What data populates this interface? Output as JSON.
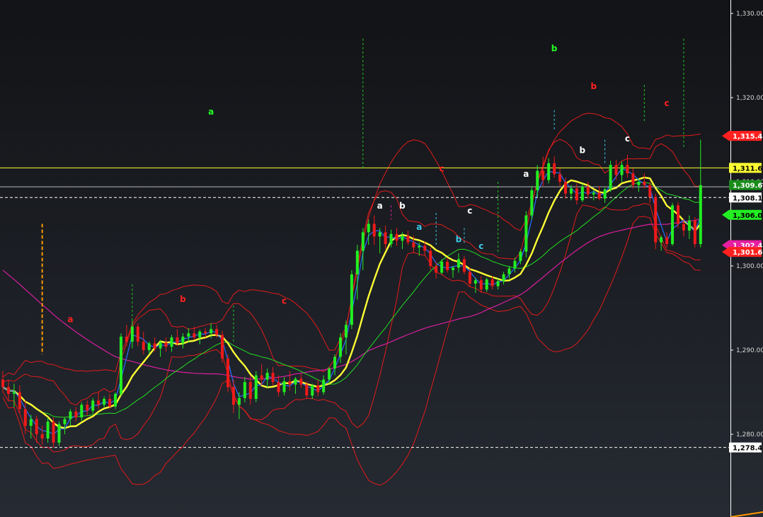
{
  "chart_data": {
    "type": "candlestick",
    "y_axis": {
      "min": 1275,
      "max": 1332,
      "ticks": [
        "1,330.00",
        "1,320.00",
        "1,310.00",
        "1,300.00",
        "1,290.00",
        "1,280.00"
      ],
      "tick_values": [
        1330,
        1320,
        1310,
        1300,
        1290,
        1280
      ],
      "position": "right"
    },
    "grid": false,
    "price_labels": [
      {
        "text": "1,315.45",
        "value": 1315.45,
        "bg": "#ff2020",
        "fg": "#ffffff",
        "shape": "arrow"
      },
      {
        "text": "1,311.65",
        "value": 1311.65,
        "bg": "#ffff33",
        "fg": "#000000",
        "shape": "box"
      },
      {
        "text": "1,309.61",
        "value": 1309.61,
        "bg": "#1a8c1a",
        "fg": "#ffffff",
        "shape": "box"
      },
      {
        "text": "1,308.13",
        "value": 1308.13,
        "bg": "#ffffff",
        "fg": "#000000",
        "shape": "box"
      },
      {
        "text": "1,306.07",
        "value": 1306.07,
        "bg": "#22ee22",
        "fg": "#000000",
        "shape": "arrow"
      },
      {
        "text": "1,302.47",
        "value": 1302.47,
        "bg": "#e61ea0",
        "fg": "#ffffff",
        "shape": "arrow"
      },
      {
        "text": "1,301.67",
        "value": 1301.67,
        "bg": "#ff2020",
        "fg": "#ffffff",
        "shape": "arrow"
      },
      {
        "text": "1,278.43",
        "value": 1278.43,
        "bg": "#ffffff",
        "fg": "#000000",
        "shape": "box"
      }
    ],
    "horizontal_lines": [
      {
        "value": 1311.65,
        "color": "#ffff33",
        "style": "solid"
      },
      {
        "value": 1309.4,
        "color": "#bbbbbb",
        "style": "solid"
      },
      {
        "value": 1308.13,
        "color": "#ffffff",
        "style": "dashed"
      },
      {
        "value": 1278.43,
        "color": "#ffffff",
        "style": "dashed"
      }
    ],
    "wave_labels": [
      {
        "text": "a",
        "bar": 37,
        "value": 1318.0,
        "color": "#22ff22"
      },
      {
        "text": "b",
        "bar": 98,
        "value": 1325.5,
        "color": "#22ff22"
      },
      {
        "text": "a",
        "bar": 12,
        "value": 1293.3,
        "color": "#ff2020"
      },
      {
        "text": "b",
        "bar": 32,
        "value": 1295.7,
        "color": "#ff2020"
      },
      {
        "text": "c",
        "bar": 50,
        "value": 1295.5,
        "color": "#ff2020"
      },
      {
        "text": "c",
        "bar": 78,
        "value": 1311.2,
        "color": "#ff2020"
      },
      {
        "text": "b",
        "bar": 105,
        "value": 1321.0,
        "color": "#ff2020"
      },
      {
        "text": "c",
        "bar": 118,
        "value": 1319.0,
        "color": "#ff2020"
      },
      {
        "text": "a",
        "bar": 67,
        "value": 1306.8,
        "color": "#ffffff"
      },
      {
        "text": "b",
        "bar": 71,
        "value": 1306.8,
        "color": "#ffffff"
      },
      {
        "text": "c",
        "bar": 83,
        "value": 1306.2,
        "color": "#ffffff"
      },
      {
        "text": "a",
        "bar": 93,
        "value": 1310.6,
        "color": "#ffffff"
      },
      {
        "text": "b",
        "bar": 103,
        "value": 1313.4,
        "color": "#ffffff"
      },
      {
        "text": "c",
        "bar": 111,
        "value": 1314.8,
        "color": "#ffffff"
      },
      {
        "text": "a",
        "bar": 74,
        "value": 1304.3,
        "color": "#3fc8e6"
      },
      {
        "text": "b",
        "bar": 81,
        "value": 1302.8,
        "color": "#3fc8e6"
      },
      {
        "text": "c",
        "bar": 85,
        "value": 1302.0,
        "color": "#3fc8e6"
      }
    ],
    "vertical_markers": [
      {
        "bar": 7,
        "top": 1305.0,
        "bottom": 1289.5,
        "color": "#ff9900"
      },
      {
        "bar": 64,
        "top": 1327.0,
        "bottom": 1311.5,
        "color": "#22cc22"
      },
      {
        "bar": 98,
        "top": 1318.5,
        "bottom": 1316.2,
        "color": "#3fc8e6"
      },
      {
        "bar": 114,
        "top": 1321.5,
        "bottom": 1317.2,
        "color": "#22cc22"
      },
      {
        "bar": 121,
        "top": 1327.0,
        "bottom": 1314.0,
        "color": "#22cc22"
      },
      {
        "bar": 23,
        "top": 1297.8,
        "bottom": 1293.5,
        "color": "#22cc22"
      },
      {
        "bar": 41,
        "top": 1295.3,
        "bottom": 1290.8,
        "color": "#22cc22"
      },
      {
        "bar": 88,
        "top": 1310.0,
        "bottom": 1301.5,
        "color": "#22cc22"
      },
      {
        "bar": 77,
        "top": 1306.3,
        "bottom": 1302.5,
        "color": "#3fc8e6"
      },
      {
        "bar": 82,
        "top": 1304.5,
        "bottom": 1302.5,
        "color": "#3fc8e6"
      },
      {
        "bar": 107,
        "top": 1315.0,
        "bottom": 1312.0,
        "color": "#3fc8e6"
      },
      {
        "bar": 69,
        "top": 1307.2,
        "bottom": 1305.5,
        "color": "#e61ea0"
      }
    ],
    "candles": [
      [
        1286.5,
        1287.5,
        1285.0,
        1285.6
      ],
      [
        1285.6,
        1286.4,
        1284.0,
        1284.8
      ],
      [
        1284.8,
        1286.0,
        1283.2,
        1285.0
      ],
      [
        1285.0,
        1285.8,
        1282.5,
        1283.0
      ],
      [
        1283.0,
        1284.0,
        1280.0,
        1281.0
      ],
      [
        1281.0,
        1282.3,
        1279.5,
        1281.8
      ],
      [
        1281.8,
        1282.2,
        1279.0,
        1280.0
      ],
      [
        1280.0,
        1281.0,
        1278.8,
        1279.5
      ],
      [
        1279.5,
        1282.0,
        1279.0,
        1281.5
      ],
      [
        1281.5,
        1282.0,
        1278.4,
        1279.0
      ],
      [
        1279.0,
        1281.5,
        1278.6,
        1281.2
      ],
      [
        1281.2,
        1282.0,
        1280.0,
        1281.8
      ],
      [
        1281.8,
        1283.0,
        1281.0,
        1282.7
      ],
      [
        1282.7,
        1283.2,
        1281.5,
        1282.0
      ],
      [
        1282.0,
        1283.8,
        1281.6,
        1283.5
      ],
      [
        1283.5,
        1284.0,
        1282.2,
        1282.8
      ],
      [
        1282.8,
        1284.3,
        1282.4,
        1284.0
      ],
      [
        1284.0,
        1285.0,
        1283.0,
        1283.5
      ],
      [
        1283.5,
        1284.5,
        1283.2,
        1284.2
      ],
      [
        1284.2,
        1284.8,
        1283.0,
        1283.3
      ],
      [
        1283.3,
        1285.0,
        1283.0,
        1284.8
      ],
      [
        1284.8,
        1292.0,
        1284.5,
        1291.6
      ],
      [
        1291.6,
        1293.0,
        1290.5,
        1291.0
      ],
      [
        1291.0,
        1293.5,
        1290.2,
        1292.8
      ],
      [
        1292.8,
        1293.2,
        1290.5,
        1291.0
      ],
      [
        1291.0,
        1292.2,
        1289.5,
        1290.0
      ],
      [
        1290.0,
        1291.0,
        1289.5,
        1290.8
      ],
      [
        1290.8,
        1291.5,
        1289.8,
        1290.2
      ],
      [
        1290.2,
        1291.2,
        1289.2,
        1290.9
      ],
      [
        1290.9,
        1291.5,
        1289.8,
        1290.4
      ],
      [
        1290.4,
        1291.8,
        1289.8,
        1291.5
      ],
      [
        1291.5,
        1292.5,
        1290.5,
        1290.8
      ],
      [
        1290.8,
        1292.0,
        1290.2,
        1291.6
      ],
      [
        1291.6,
        1292.6,
        1290.9,
        1292.0
      ],
      [
        1292.0,
        1292.8,
        1291.2,
        1291.5
      ],
      [
        1291.5,
        1292.4,
        1290.7,
        1292.2
      ],
      [
        1292.2,
        1292.6,
        1291.5,
        1292.0
      ],
      [
        1292.0,
        1293.2,
        1291.4,
        1292.5
      ],
      [
        1292.5,
        1293.0,
        1291.5,
        1291.8
      ],
      [
        1291.8,
        1292.3,
        1288.5,
        1289.0
      ],
      [
        1289.0,
        1289.5,
        1285.0,
        1285.6
      ],
      [
        1285.6,
        1286.5,
        1282.5,
        1283.5
      ],
      [
        1283.5,
        1285.0,
        1281.8,
        1284.3
      ],
      [
        1284.3,
        1286.8,
        1283.8,
        1286.2
      ],
      [
        1286.2,
        1287.0,
        1283.5,
        1284.2
      ],
      [
        1284.2,
        1287.5,
        1283.8,
        1287.0
      ],
      [
        1287.0,
        1288.3,
        1285.8,
        1286.5
      ],
      [
        1286.5,
        1287.8,
        1285.5,
        1287.3
      ],
      [
        1287.3,
        1288.0,
        1285.8,
        1286.2
      ],
      [
        1286.2,
        1287.0,
        1284.5,
        1285.0
      ],
      [
        1285.0,
        1286.8,
        1284.6,
        1286.3
      ],
      [
        1286.3,
        1287.5,
        1285.2,
        1285.9
      ],
      [
        1285.9,
        1286.8,
        1284.8,
        1286.6
      ],
      [
        1286.6,
        1287.2,
        1285.5,
        1285.9
      ],
      [
        1285.9,
        1286.3,
        1284.2,
        1284.6
      ],
      [
        1284.6,
        1286.0,
        1284.2,
        1285.8
      ],
      [
        1285.8,
        1286.5,
        1284.5,
        1285.0
      ],
      [
        1285.0,
        1287.0,
        1284.7,
        1286.5
      ],
      [
        1286.5,
        1288.0,
        1286.0,
        1287.8
      ],
      [
        1287.8,
        1289.5,
        1287.0,
        1289.2
      ],
      [
        1289.2,
        1292.0,
        1288.5,
        1291.5
      ],
      [
        1291.5,
        1293.5,
        1289.5,
        1293.0
      ],
      [
        1293.0,
        1299.5,
        1292.5,
        1299.0
      ],
      [
        1299.0,
        1302.5,
        1296.0,
        1301.8
      ],
      [
        1301.8,
        1304.5,
        1299.5,
        1304.0
      ],
      [
        1304.0,
        1305.5,
        1302.5,
        1305.0
      ],
      [
        1305.0,
        1306.0,
        1302.5,
        1303.5
      ],
      [
        1303.5,
        1304.5,
        1301.5,
        1304.0
      ],
      [
        1304.0,
        1304.8,
        1302.0,
        1302.6
      ],
      [
        1302.6,
        1304.3,
        1302.2,
        1303.8
      ],
      [
        1303.8,
        1304.5,
        1302.4,
        1303.0
      ],
      [
        1303.0,
        1304.0,
        1302.0,
        1303.6
      ],
      [
        1303.6,
        1304.2,
        1302.5,
        1302.8
      ],
      [
        1302.8,
        1303.6,
        1301.5,
        1302.2
      ],
      [
        1302.2,
        1302.8,
        1301.2,
        1302.4
      ],
      [
        1302.4,
        1302.9,
        1301.2,
        1301.8
      ],
      [
        1301.8,
        1302.2,
        1299.5,
        1300.0
      ],
      [
        1300.0,
        1300.5,
        1298.5,
        1299.2
      ],
      [
        1299.2,
        1300.8,
        1299.0,
        1300.5
      ],
      [
        1300.5,
        1301.0,
        1299.2,
        1299.5
      ],
      [
        1299.5,
        1300.0,
        1298.6,
        1299.8
      ],
      [
        1299.8,
        1301.5,
        1299.2,
        1300.8
      ],
      [
        1300.8,
        1301.2,
        1299.0,
        1299.3
      ],
      [
        1299.3,
        1299.8,
        1297.5,
        1297.9
      ],
      [
        1297.9,
        1298.6,
        1296.8,
        1298.3
      ],
      [
        1298.3,
        1298.8,
        1296.8,
        1297.2
      ],
      [
        1297.2,
        1298.6,
        1296.9,
        1298.4
      ],
      [
        1298.4,
        1298.8,
        1297.2,
        1297.6
      ],
      [
        1297.6,
        1298.5,
        1297.2,
        1298.2
      ],
      [
        1298.2,
        1299.3,
        1297.8,
        1299.0
      ],
      [
        1299.0,
        1300.0,
        1298.5,
        1299.7
      ],
      [
        1299.7,
        1301.0,
        1299.2,
        1300.6
      ],
      [
        1300.6,
        1302.0,
        1300.2,
        1301.7
      ],
      [
        1301.7,
        1306.5,
        1301.0,
        1306.0
      ],
      [
        1306.0,
        1309.5,
        1305.5,
        1309.0
      ],
      [
        1309.0,
        1312.0,
        1308.2,
        1311.3
      ],
      [
        1311.3,
        1313.0,
        1309.5,
        1310.2
      ],
      [
        1310.2,
        1312.8,
        1309.8,
        1312.2
      ],
      [
        1312.2,
        1313.0,
        1310.5,
        1310.9
      ],
      [
        1310.9,
        1311.6,
        1309.5,
        1310.0
      ],
      [
        1310.0,
        1310.5,
        1308.0,
        1308.6
      ],
      [
        1308.6,
        1309.6,
        1307.8,
        1309.2
      ],
      [
        1309.2,
        1309.8,
        1307.3,
        1307.8
      ],
      [
        1307.8,
        1309.8,
        1307.6,
        1309.4
      ],
      [
        1309.4,
        1310.0,
        1308.0,
        1308.5
      ],
      [
        1308.5,
        1309.0,
        1307.8,
        1308.7
      ],
      [
        1308.7,
        1309.5,
        1307.8,
        1308.0
      ],
      [
        1308.0,
        1309.3,
        1307.5,
        1309.1
      ],
      [
        1309.1,
        1312.5,
        1308.8,
        1312.0
      ],
      [
        1312.0,
        1312.6,
        1310.2,
        1310.8
      ],
      [
        1310.8,
        1312.4,
        1310.0,
        1312.0
      ],
      [
        1312.0,
        1313.2,
        1310.5,
        1311.0
      ],
      [
        1311.0,
        1311.6,
        1309.2,
        1309.6
      ],
      [
        1309.6,
        1310.4,
        1308.8,
        1310.0
      ],
      [
        1310.0,
        1311.0,
        1309.2,
        1309.6
      ],
      [
        1309.6,
        1310.0,
        1307.5,
        1308.2
      ],
      [
        1308.2,
        1308.6,
        1302.0,
        1302.8
      ],
      [
        1302.8,
        1303.6,
        1301.8,
        1303.4
      ],
      [
        1303.4,
        1304.0,
        1302.2,
        1302.6
      ],
      [
        1302.6,
        1307.5,
        1302.4,
        1307.2
      ],
      [
        1307.2,
        1307.6,
        1304.5,
        1305.0
      ],
      [
        1305.0,
        1305.6,
        1303.5,
        1304.2
      ],
      [
        1304.2,
        1306.0,
        1303.2,
        1305.4
      ],
      [
        1305.4,
        1305.8,
        1302.2,
        1302.6
      ],
      [
        1302.6,
        1315.0,
        1302.2,
        1309.6
      ]
    ]
  }
}
